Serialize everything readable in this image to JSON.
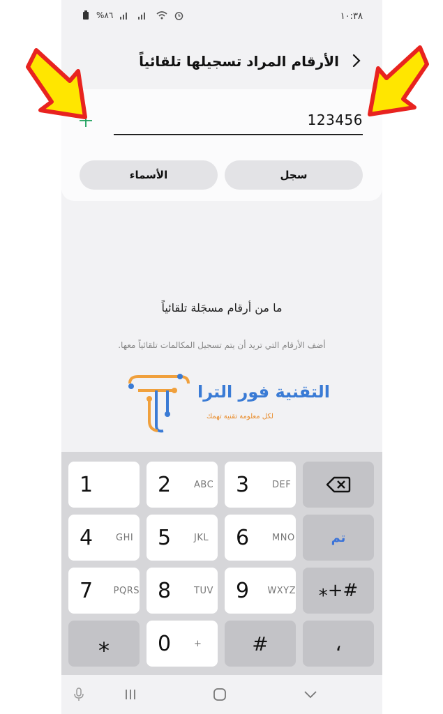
{
  "status_bar": {
    "time": "١٠:٣٨",
    "battery": "%٨٦"
  },
  "header": {
    "title": "الأرقام المراد تسجيلها تلقائياً"
  },
  "number_input": {
    "value": "123456"
  },
  "buttons": {
    "log": "سجل",
    "contacts": "الأسماء"
  },
  "empty_state": {
    "title": "ما من أرقام مسجَلة تلقائياً",
    "description": "أضف الأرقام التي تريد أن يتم تسجيل المكالمات تلقائياً معها."
  },
  "watermark": {
    "name": "التقنية فور الترا",
    "tagline": "لكل معلومة تقنية تهمك"
  },
  "keypad": {
    "k1": {
      "digit": "1",
      "letters": ""
    },
    "k2": {
      "digit": "2",
      "letters": "ABC"
    },
    "k3": {
      "digit": "3",
      "letters": "DEF"
    },
    "k4": {
      "digit": "4",
      "letters": "GHI"
    },
    "k5": {
      "digit": "5",
      "letters": "JKL"
    },
    "k6": {
      "digit": "6",
      "letters": "MNO"
    },
    "k7": {
      "digit": "7",
      "letters": "PQRS"
    },
    "k8": {
      "digit": "8",
      "letters": "TUV"
    },
    "k9": {
      "digit": "9",
      "letters": "WXYZ"
    },
    "k0": {
      "digit": "0",
      "letters": "+"
    },
    "star": "⁎",
    "hash": "#",
    "comma": "،",
    "symbols": "⁎+#",
    "done": "تم"
  },
  "colors": {
    "accent_green": "#1a9e5a",
    "done_blue": "#3b73d8",
    "arrow_yellow": "#ffe600",
    "arrow_red": "#e8231f"
  }
}
